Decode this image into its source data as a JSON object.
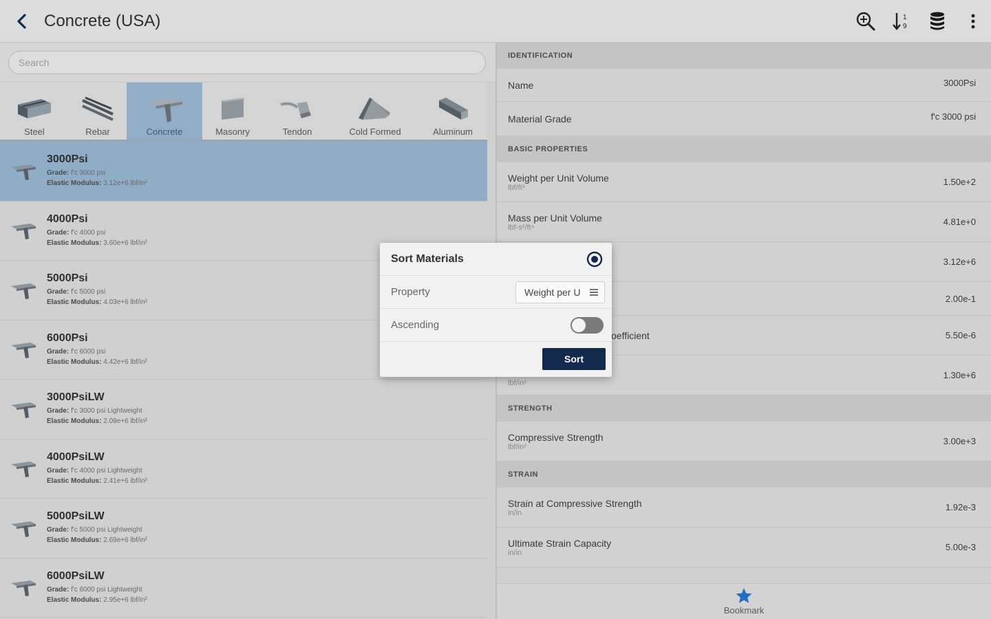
{
  "appbar": {
    "title": "Concrete (USA)",
    "actions": [
      {
        "name": "search-zoom-icon"
      },
      {
        "name": "sort-numeric-icon"
      },
      {
        "name": "database-icon"
      },
      {
        "name": "more-vert-icon"
      }
    ]
  },
  "search": {
    "placeholder": "Search"
  },
  "categories": [
    {
      "label": "Steel",
      "width": 100
    },
    {
      "label": "Rebar",
      "width": 84
    },
    {
      "label": "Concrete",
      "width": 110
    },
    {
      "label": "Masonry",
      "width": 88
    },
    {
      "label": "Tendon",
      "width": 100
    },
    {
      "label": "Cold Formed",
      "width": 126
    },
    {
      "label": "Aluminum",
      "width": 100
    }
  ],
  "active_category": "Concrete",
  "materials": [
    {
      "title": "3000Psi",
      "grade_label": "Grade:",
      "grade": "f'c 3000 psi",
      "modulus_label": "Elastic Modulus:",
      "modulus": "3.12e+6 lbf/in²"
    },
    {
      "title": "4000Psi",
      "grade_label": "Grade:",
      "grade": "f'c 4000 psi",
      "modulus_label": "Elastic Modulus:",
      "modulus": "3.60e+6 lbf/in²"
    },
    {
      "title": "5000Psi",
      "grade_label": "Grade:",
      "grade": "f'c 5000 psi",
      "modulus_label": "Elastic Modulus:",
      "modulus": "4.03e+6 lbf/in²"
    },
    {
      "title": "6000Psi",
      "grade_label": "Grade:",
      "grade": "f'c 6000 psi",
      "modulus_label": "Elastic Modulus:",
      "modulus": "4.42e+6 lbf/in²"
    },
    {
      "title": "3000PsiLW",
      "grade_label": "Grade:",
      "grade": "f'c 3000 psi Lightweight",
      "modulus_label": "Elastic Modulus:",
      "modulus": "2.09e+6 lbf/in²"
    },
    {
      "title": "4000PsiLW",
      "grade_label": "Grade:",
      "grade": "f'c 4000 psi Lightweight",
      "modulus_label": "Elastic Modulus:",
      "modulus": "2.41e+6 lbf/in²"
    },
    {
      "title": "5000PsiLW",
      "grade_label": "Grade:",
      "grade": "f'c 5000 psi Lightweight",
      "modulus_label": "Elastic Modulus:",
      "modulus": "2.69e+6 lbf/in²"
    },
    {
      "title": "6000PsiLW",
      "grade_label": "Grade:",
      "grade": "f'c 6000 psi Lightweight",
      "modulus_label": "Elastic Modulus:",
      "modulus": "2.95e+6 lbf/in²"
    }
  ],
  "details": {
    "identification": "IDENTIFICATION",
    "name_label": "Name",
    "name_value": "3000Psi",
    "grade_label": "Material Grade",
    "grade_value": "f'c 3000 psi",
    "basic": "BASIC PROPERTIES",
    "weight_label": "Weight per Unit Volume",
    "weight_unit": "lbf/ft³",
    "weight_value": "1.50e+2",
    "mass_label": "Mass per Unit Volume",
    "mass_unit": "lbf-s²/ft⁴",
    "mass_value": "4.81e+0",
    "modulus_value": "3.12e+6",
    "poisson_value": "2.00e-1",
    "thermal_partial": "oefficient",
    "thermal_value": "5.50e-6",
    "shear_unit": "lbf/in²",
    "shear_value": "1.30e+6",
    "strength": "STRENGTH",
    "comp_label": "Compressive Strength",
    "comp_unit": "lbf/in²",
    "comp_value": "3.00e+3",
    "strain": "STRAIN",
    "strain_comp_label": "Strain at Compressive Strength",
    "strain_comp_unit": "in/in",
    "strain_comp_value": "1.92e-3",
    "ult_label": "Ultimate Strain Capacity",
    "ult_unit": "in/in",
    "ult_value": "5.00e-3"
  },
  "bookmark": {
    "label": "Bookmark",
    "color": "#1f6fc4"
  },
  "dialog": {
    "title": "Sort Materials",
    "property_label": "Property",
    "property_value": "Weight per U",
    "ascending_label": "Ascending",
    "ascending": false,
    "sort_label": "Sort"
  },
  "colors": {
    "selected": "#90adc6",
    "button": "#13294b"
  }
}
